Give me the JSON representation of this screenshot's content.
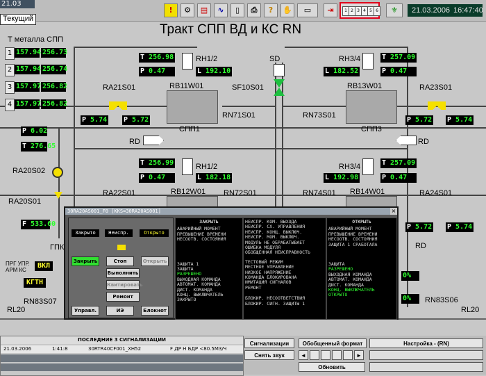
{
  "header": {
    "corner_time": "21.03",
    "current_label": "Текущий",
    "title": "Тракт СПП ВД и КС   RN",
    "date": "21.03.2006",
    "time": "16:47:40",
    "sheet_tabs": [
      "1",
      "2",
      "3",
      "4",
      "5",
      "6"
    ]
  },
  "metal_temp": {
    "label": "Т металла СПП",
    "rows": [
      {
        "n": "1",
        "a": "157.94",
        "b": "256.73"
      },
      {
        "n": "2",
        "a": "157.94",
        "b": "256.74"
      },
      {
        "n": "3",
        "a": "157.97",
        "b": "256.82"
      },
      {
        "n": "4",
        "a": "157.97",
        "b": "256.82"
      }
    ]
  },
  "left_params": {
    "p": "6.02",
    "t": "276.65",
    "f": "533.60"
  },
  "upper_left": {
    "t": "256.98",
    "p": "0.47",
    "rh": "RH1/2",
    "l": "192.10",
    "ra": "RA21S01",
    "rb": "RB11W01",
    "spp": "СПП1",
    "p1": "5.74",
    "p2": "5.72",
    "rn": "RN71S01",
    "rd": "RD",
    "sf": "SF10S01",
    "sd": "SD"
  },
  "upper_right": {
    "t": "257.09",
    "p": "0.47",
    "rh": "RH3/4",
    "l": "182.52",
    "ra": "RA23S01",
    "rb": "RB13W01",
    "spp": "СПП3",
    "p1": "5.72",
    "p2": "5.74",
    "rn": "RN73S01",
    "rd": "RD"
  },
  "lower_left": {
    "t": "256.99",
    "p": "0.47",
    "rh": "RH1/2",
    "l": "182.18",
    "ra": "RA22S01",
    "rb": "RB12W01",
    "rn": "RN72S01"
  },
  "lower_right": {
    "t": "257.09",
    "p": "0.47",
    "rh": "RH3/4",
    "l": "192.98",
    "ra": "RA24S01",
    "rb": "RB14W01",
    "rn": "RN74S01",
    "p1": "5.72",
    "p2": "5.74",
    "rd": "RD",
    "pct1": "0%",
    "pct2": "0%"
  },
  "left_valves": {
    "ra20s02": "RA20S02",
    "ra20s01": "RA20S01",
    "ggk": "ГПК",
    "prg": "ПРГ УПР.",
    "arm": "АРМ КС",
    "vkl": "ВКЛ",
    "kgtn": "КГТН",
    "rn83s07": "RN83S07",
    "rl20": "RL20",
    "rn83s06": "RN83S06",
    "rl20r": "RL20"
  },
  "dialog": {
    "title": "30RA20AS001_F0 [KKS=30RA20AS001]",
    "btn_close": "Закрыто",
    "btn_fault": "Неиспр.",
    "btn_open": "Открыто",
    "btn_zakryt": "Закрыть",
    "btn_stop": "Стоп",
    "btn_otkryt": "Открыть",
    "btn_exec": "Выполнить",
    "btn_quit": "Квитировать",
    "btn_repair": "Ремонт",
    "btn_upr": "Управл.",
    "btn_ie": "ИЭ",
    "btn_notepad": "Блокнот",
    "h_close": "ЗАКРЫТЬ",
    "h_open": "ОТКРЫТЬ",
    "col1_top": "АВАРИЙНЫЙ МОМЕНТ\nПРЕВЫШЕНИЕ ВРЕМЕНИ\nНЕСООТВ. СОСТОЯНИЯ",
    "col2_top": "НЕИСПР. КОМ. ВЫХОДА\nНЕИСПР. СХ. УПРАВЛЕНИЯ\nНЕИСПР. КОНЦ. ВЫКЛЮЧ.\nНЕИСПР. МОМ. ВЫКЛЮЧ.\nМОДУЛЬ НЕ ОБРАБАТЫВАЕТ\nОШИБКА МОДУЛЯ\nОБОБЩЕННАЯ НЕИСПРАВНОСТЬ",
    "col3_top": "АВАРИЙНЫЙ МОМЕНТ\nПРЕВЫШЕНИЕ ВРЕМЕНИ\nНЕСООТВ. СОСТОЯНИЯ\nЗАЩИТА 1 СРАБОТАЛА",
    "col1_bot_a": "ЗАЩИТА 1\nЗАЩИТА",
    "col1_bot_g": "РАЗРЕШЕНО",
    "col1_bot_b": "ВЫХОДНАЯ КОМАНДА\nАВТОМАТ. КОМАНДА\nДИСТ. КОМАНДА\nКОНЦ. ВЫКЛЮЧАТЕЛЬ\nЗАКРЫТО",
    "col2_bot": "ТЕСТОВЫЙ РЕЖИМ\nМЕСТНОЕ УПРАВЛЕНИЕ\nНИЗКОЕ НАПРЯЖЕНИЕ\nКОМАНДА БЛОКИРОВАНА\nИМИТАЦИЯ СИГНАЛОВ\nРЕМОНТ",
    "col2_bot2": "БЛОКИР. НЕСООТВЕТСТВИЯ\nБЛОКИР. СИГН. ЗАЩИТЫ 1",
    "col3_bot_a": "ЗАЩИТА",
    "col3_bot_g": "РАЗРЕШЕНО",
    "col3_bot_b": "ВЫХОДНАЯ КОМАНДА\nАВТОМАТ. КОМАНДА\nДИСТ. КОМАНДА",
    "col3_bot_g2": "КОНЦ. ВЫКЛЮЧАТЕЛЬ\nОТКРЫТО"
  },
  "alarms": {
    "header": "ПОСЛЕДНИЕ 3 СИГНАЛИЗАЦИИ",
    "rows": [
      {
        "date": "21.03.2006",
        "time": "1:41:8",
        "kks": "30RTR40CF001_XH52",
        "msg": "F ДР Н БДР <80.5М3/Ч"
      },
      {
        "date": "",
        "time": "",
        "kks": "",
        "msg": ""
      },
      {
        "date": "",
        "time": "",
        "kks": "",
        "msg": ""
      }
    ]
  },
  "bottom": {
    "signals": "Сигнализации",
    "mute": "Снять звук",
    "format": "Обобщенный формат",
    "settings": "Настройка - (RN)",
    "refresh": "Обновить"
  }
}
